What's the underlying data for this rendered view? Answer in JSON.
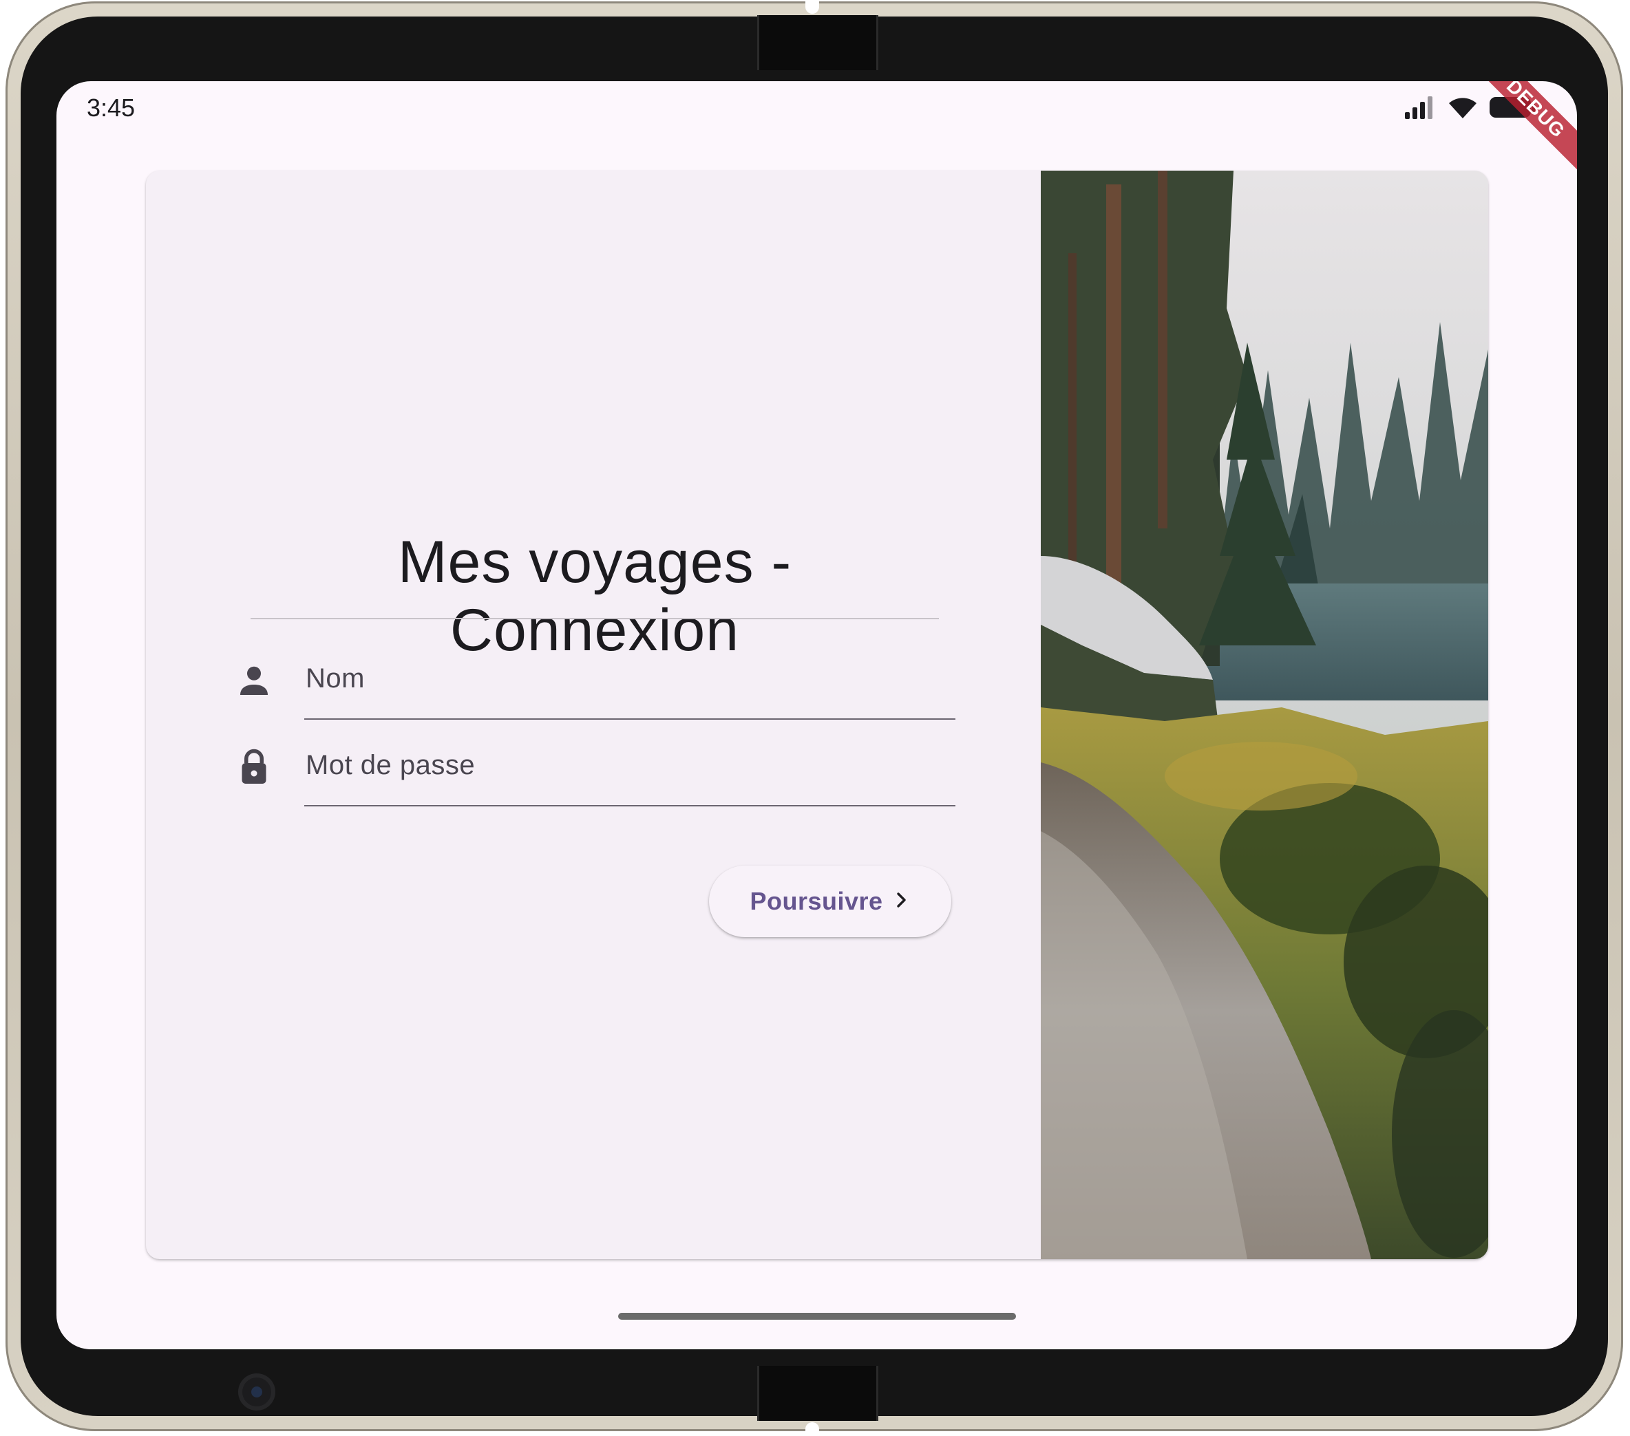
{
  "status_bar": {
    "time": "3:45",
    "debug_banner": "DEBUG"
  },
  "login": {
    "title": "Mes voyages - Connexion",
    "name_field": {
      "label": "Nom",
      "value": "",
      "icon": "person-icon"
    },
    "password_field": {
      "label": "Mot de passe",
      "value": "",
      "icon": "lock-icon"
    },
    "continue_button": {
      "label": "Poursuivre",
      "icon": "chevron-right-icon"
    }
  },
  "image": {
    "subject": "forest trail by a lake"
  },
  "colors": {
    "background": "#fdf7fd",
    "card": "#f5eff6",
    "accent": "#65558f",
    "text": "#1c1b1f",
    "debug_banner": "#b82030"
  }
}
